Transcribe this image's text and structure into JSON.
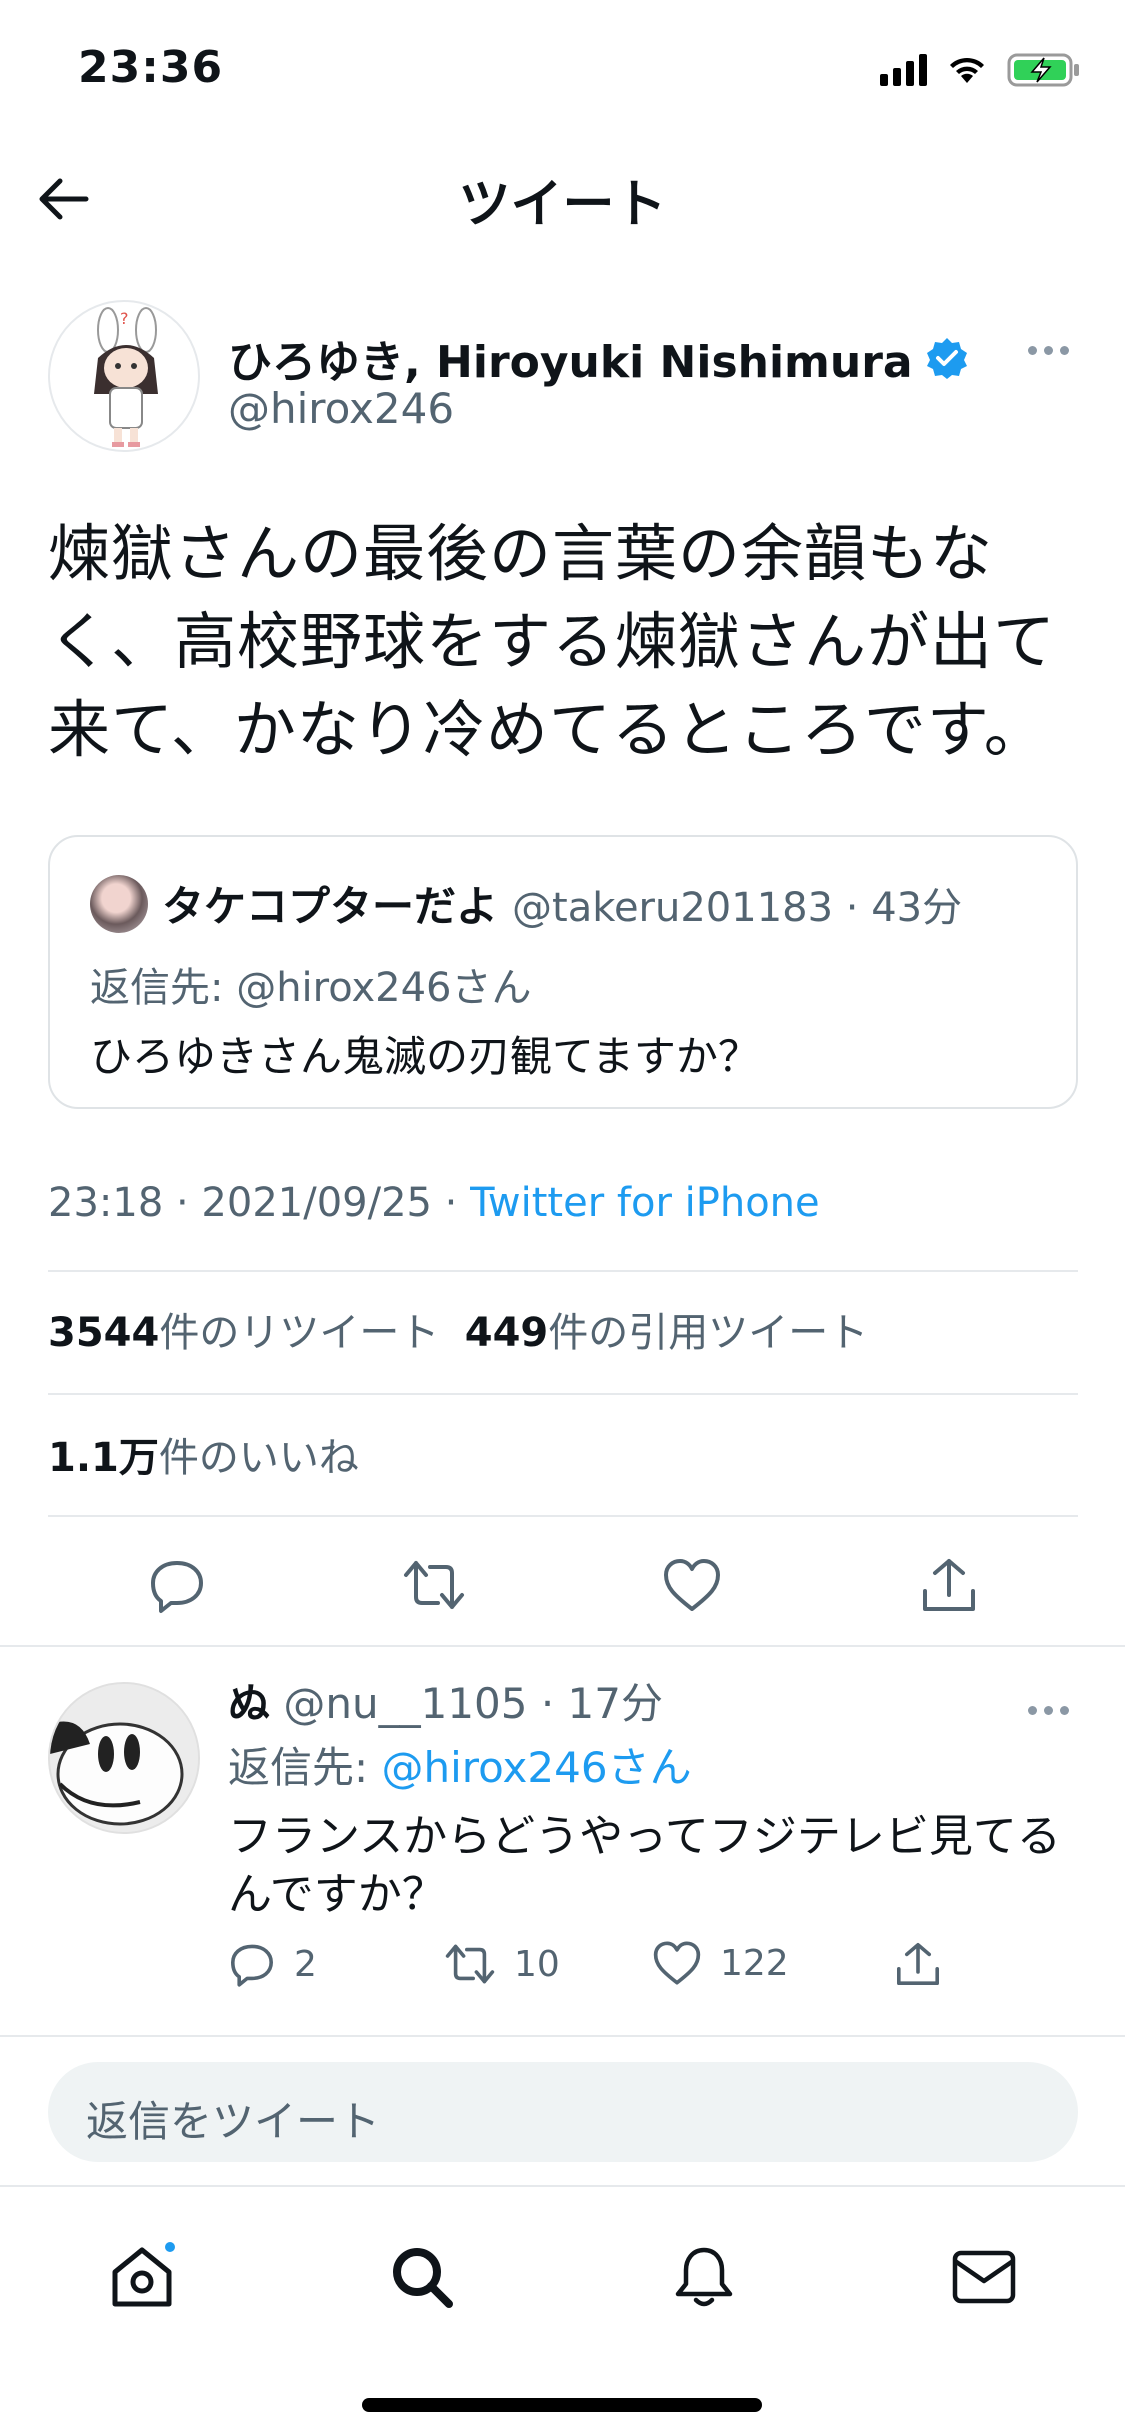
{
  "status_bar": {
    "time": "23:36"
  },
  "header": {
    "title": "ツイート"
  },
  "tweet": {
    "author_name": "ひろゆき, Hiroyuki Nishimura",
    "author_handle": "@hirox246",
    "text": "煉獄さんの最後の言葉の余韻もなく、高校野球をする煉獄さんが出て来て、かなり冷めてるところです。",
    "quoted": {
      "name": "タケコプターだよ",
      "handle_time": "@takeru201183 · 43分",
      "reply_to": "返信先: @hirox246さん",
      "text": "ひろゆきさん鬼滅の刃観てますか？"
    },
    "time": "23:18 · 2021/09/25 · ",
    "source": "Twitter for iPhone",
    "retweet_count": "3544",
    "retweet_label": "件のリツイート",
    "quote_count": "449",
    "quote_label": "件の引用ツイート",
    "like_count": "1.1万",
    "like_label": "件のいいね"
  },
  "reply": {
    "name": "ぬ",
    "meta": " @nu__1105 · 17分",
    "reply_prefix": "返信先: ",
    "reply_mention": "@hirox246さん",
    "text": "フランスからどうやってフジテレビ見てるんですか？",
    "reply_count": "2",
    "retweet_count": "10",
    "like_count": "122"
  },
  "compose": {
    "placeholder": "返信をツイート"
  },
  "colors": {
    "accent": "#1d9bf0",
    "secondary_text": "#536471",
    "divider": "#e6e9ec"
  },
  "icons": [
    "back-arrow-icon",
    "verified-badge-icon",
    "more-icon",
    "reply-icon",
    "retweet-icon",
    "like-icon",
    "share-icon",
    "home-icon",
    "search-icon",
    "notifications-icon",
    "messages-icon"
  ]
}
